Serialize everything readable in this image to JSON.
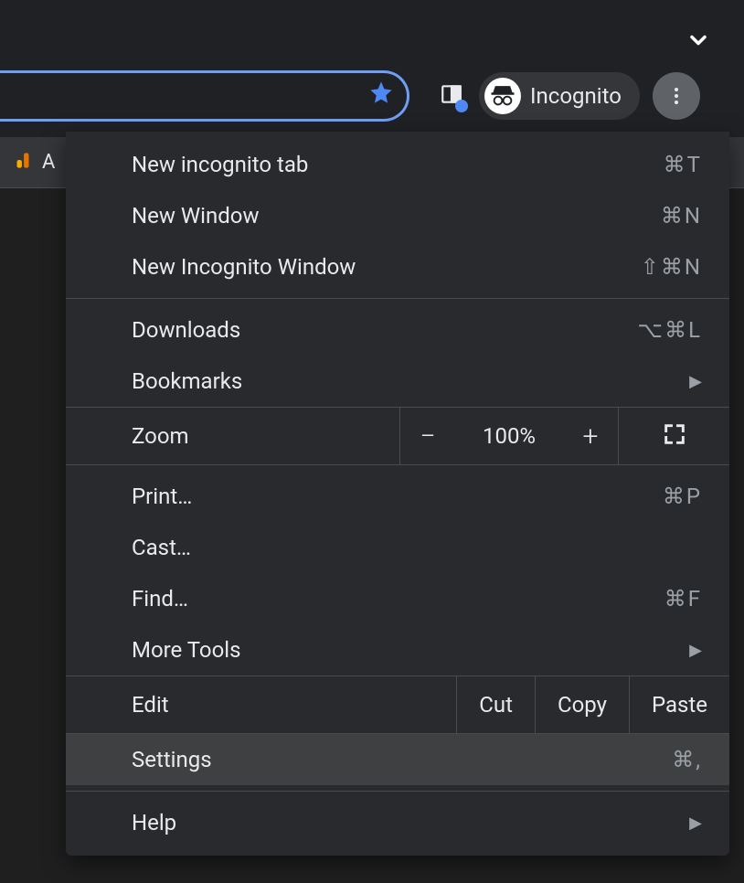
{
  "toolbar": {
    "incognito_label": "Incognito"
  },
  "bookmark": {
    "item_label": "A"
  },
  "menu": {
    "new_incognito_tab": {
      "label": "New incognito tab",
      "shortcut": "⌘T"
    },
    "new_window": {
      "label": "New Window",
      "shortcut": "⌘N"
    },
    "new_incognito_window": {
      "label": "New Incognito Window",
      "shortcut": "⇧⌘N"
    },
    "downloads": {
      "label": "Downloads",
      "shortcut": "⌥⌘L"
    },
    "bookmarks": {
      "label": "Bookmarks"
    },
    "zoom": {
      "label": "Zoom",
      "value": "100%",
      "minus": "−",
      "plus": "+"
    },
    "print": {
      "label": "Print…",
      "shortcut": "⌘P"
    },
    "cast": {
      "label": "Cast…"
    },
    "find": {
      "label": "Find…",
      "shortcut": "⌘F"
    },
    "more_tools": {
      "label": "More Tools"
    },
    "edit": {
      "label": "Edit",
      "cut": "Cut",
      "copy": "Copy",
      "paste": "Paste"
    },
    "settings": {
      "label": "Settings",
      "shortcut": "⌘,"
    },
    "help": {
      "label": "Help"
    }
  }
}
